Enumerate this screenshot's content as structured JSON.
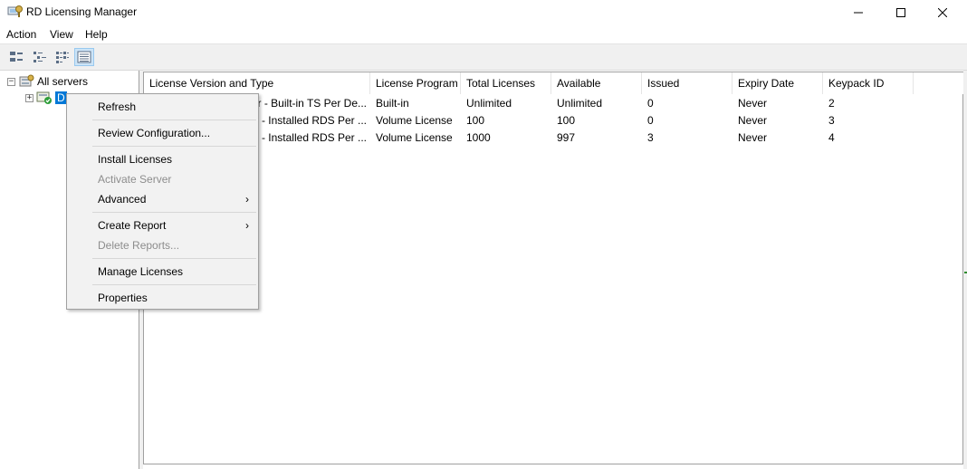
{
  "window": {
    "title": "RD Licensing Manager",
    "minimize_icon": "minimize-icon",
    "maximize_icon": "maximize-icon",
    "close_icon": "close-icon"
  },
  "menubar": {
    "items": [
      "Action",
      "View",
      "Help"
    ]
  },
  "toolbar": {
    "buttons": [
      "large-icons-view-icon",
      "small-icons-view-icon",
      "list-view-icon",
      "details-view-icon"
    ],
    "active_index": 3
  },
  "tree": {
    "root": {
      "label": "All servers",
      "icon": "servers-icon",
      "expander": "−"
    },
    "child": {
      "label": "D",
      "icon": "server-activated-icon",
      "expander": "+"
    }
  },
  "list": {
    "columns": [
      "License Version and Type",
      "License Program",
      "Total Licenses",
      "Available",
      "Issued",
      "Expiry Date",
      "Keypack ID"
    ],
    "rows": [
      [
        "er - Built-in TS Per De...",
        "Built-in",
        "Unlimited",
        "Unlimited",
        "0",
        "Never",
        "2"
      ],
      [
        "2 - Installed RDS Per ...",
        "Volume License",
        "100",
        "100",
        "0",
        "Never",
        "3"
      ],
      [
        "6 - Installed RDS Per ...",
        "Volume License",
        "1000",
        "997",
        "3",
        "Never",
        "4"
      ]
    ]
  },
  "context_menu": {
    "refresh": "Refresh",
    "review_configuration": "Review Configuration...",
    "install_licenses": "Install Licenses",
    "activate_server": "Activate Server",
    "advanced": "Advanced",
    "create_report": "Create Report",
    "delete_reports": "Delete Reports...",
    "manage_licenses": "Manage Licenses",
    "properties": "Properties",
    "submenu_arrow": "›"
  },
  "colors": {
    "selection": "#0078d7",
    "toolbar_bg": "#f0f0f0",
    "menu_bg": "#f2f2f2",
    "disabled_text": "#8d8d8d"
  }
}
